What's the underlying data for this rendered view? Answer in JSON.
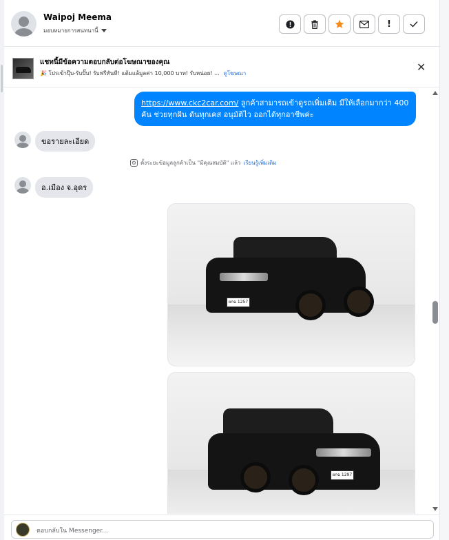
{
  "header": {
    "name": "Waipoj Meema",
    "assign_label": "มอบหมายการสนทนานี้"
  },
  "actions": [
    {
      "icon": "alert-circle-icon",
      "glyph": "⬤"
    },
    {
      "icon": "trash-icon",
      "glyph": "🗑"
    },
    {
      "icon": "star-icon",
      "glyph": "★"
    },
    {
      "icon": "mail-icon",
      "glyph": "✉"
    },
    {
      "icon": "exclamation-icon",
      "glyph": "!"
    },
    {
      "icon": "checkmark-icon",
      "glyph": "✓"
    }
  ],
  "ad": {
    "title": "แชทนี้มีข้อความตอบกลับต่อโฆษณาของคุณ",
    "subtitle": "🎉 โปรเข้าปุ๊บ-รับปั๊บ! รับฟรีทันที! แต้มแล้มูลค่า 10,000 บาท! รับหน่อย! ...",
    "link": "ดูโฆษณา",
    "close_glyph": "✕"
  },
  "messages": {
    "outgoing_link": "https://www.ckc2car.com/",
    "outgoing_text": " ลูกค้าสามารถเข้าดูรถเพิ่มเติม มีให้เลือกมากว่า 400 คัน ช่วยทุกฝัน ดันทุกเคส อนุมัติไว ออกได้ทุกอาชีพค่ะ",
    "incoming_1": "ขอรายละเอียด",
    "system_text": "ตั้งระยะข้อมูลลูกค้าเป็น \"มีคุณสมบัติ\" แล้ว",
    "system_link": "เรียนรู้เพิ่มเติม",
    "incoming_2": "อ.เมือง จ.อุดร",
    "plate_1": "ยกฉ 1257",
    "plate_2": "ยกฉ 1297"
  },
  "footer": {
    "placeholder": "ตอบกลับใน Messenger..."
  },
  "colors": {
    "accent": "#0084ff",
    "star": "#f28c1b"
  }
}
